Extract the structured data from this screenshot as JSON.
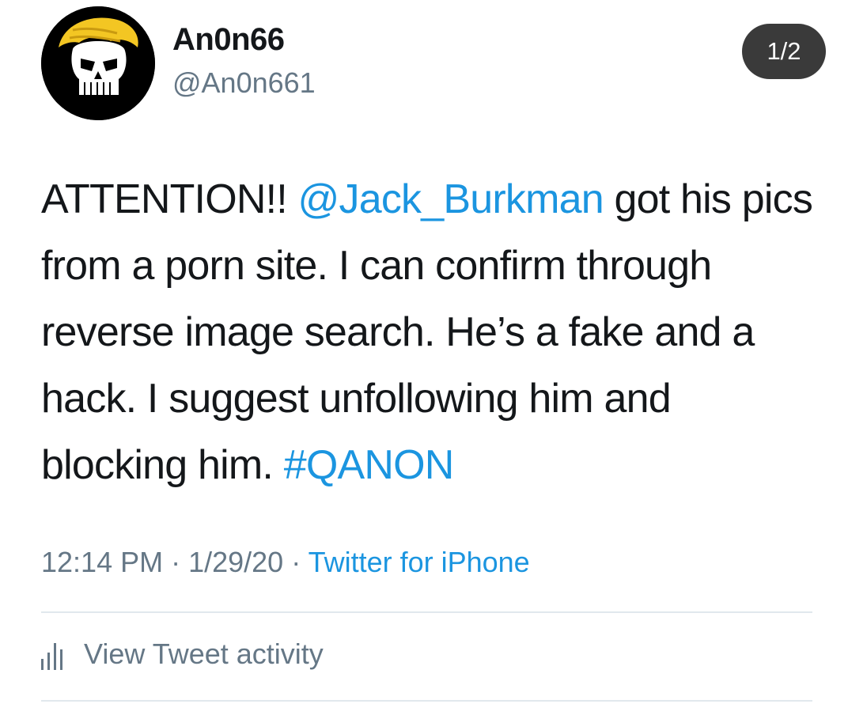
{
  "user": {
    "display_name": "An0n66",
    "handle": "@An0n661"
  },
  "page_indicator": "1/2",
  "tweet": {
    "text_1": "ATTENTION!! ",
    "mention": "@Jack_Burkman",
    "text_2": " got his pics from a porn site. I can confirm through reverse image search. He’s a fake and a hack. I suggest unfollowing him and blocking him. ",
    "hashtag": "#QANON"
  },
  "meta": {
    "time": "12:14 PM",
    "sep1": " · ",
    "date": "1/29/20",
    "sep2": " · ",
    "source": "Twitter for iPhone"
  },
  "activity": {
    "label": "View Tweet activity"
  },
  "icons": {
    "avatar": "punisher-skull-avatar",
    "activity": "bar-chart-icon"
  },
  "colors": {
    "link": "#1b95e0",
    "secondary_text": "#657786",
    "primary_text": "#14171a",
    "badge_bg": "#3a3a3a"
  }
}
